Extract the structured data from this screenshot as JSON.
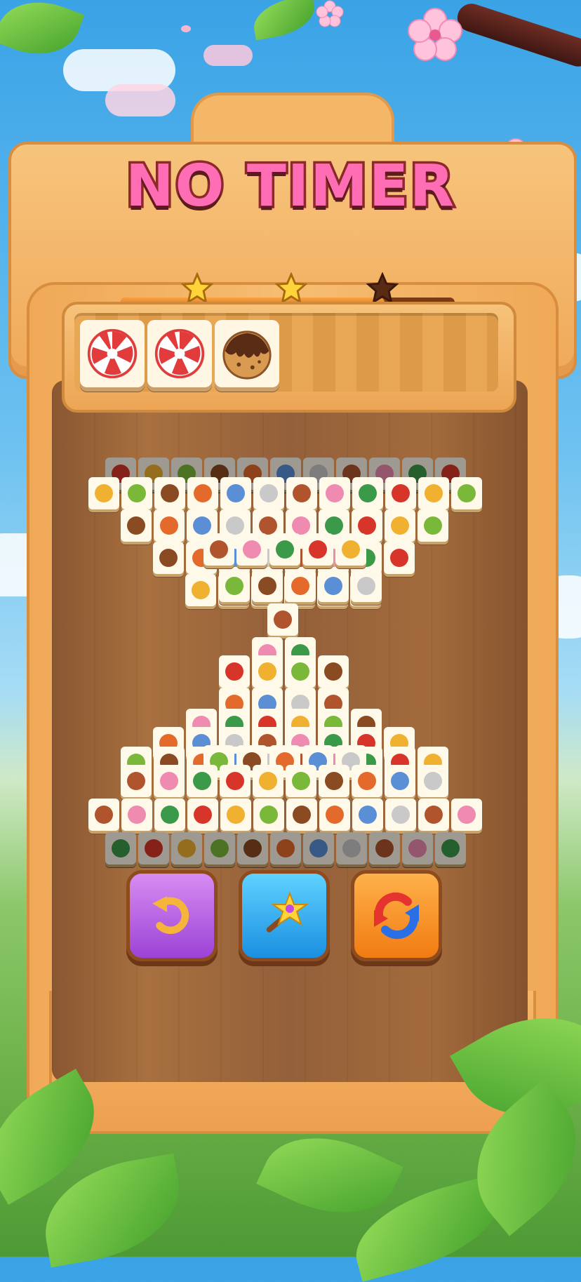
{
  "header": {
    "title": "NO TIMER"
  },
  "progress": {
    "stars_earned": 2,
    "stars_total": 3,
    "fill_fraction": 0.79
  },
  "tray": {
    "slots": 7,
    "tiles": [
      {
        "name": "peppermint-candy-tile"
      },
      {
        "name": "peppermint-candy-tile"
      },
      {
        "name": "chocolate-cookie-tile"
      }
    ]
  },
  "board": {
    "remaining_layout": "hourglass"
  },
  "buttons": {
    "undo": {
      "icon": "undo-arrow-icon",
      "color": "#a14fdc"
    },
    "hint": {
      "icon": "magic-wand-icon",
      "color": "#2a9fe6"
    },
    "shuffle": {
      "icon": "shuffle-arrows-icon",
      "color": "#f28a1e"
    }
  },
  "colors": {
    "title_pink": "#ff6eb4",
    "title_outline": "#8c2a2a",
    "frame": "#f3b767",
    "board_wood": "#a06a3c"
  }
}
